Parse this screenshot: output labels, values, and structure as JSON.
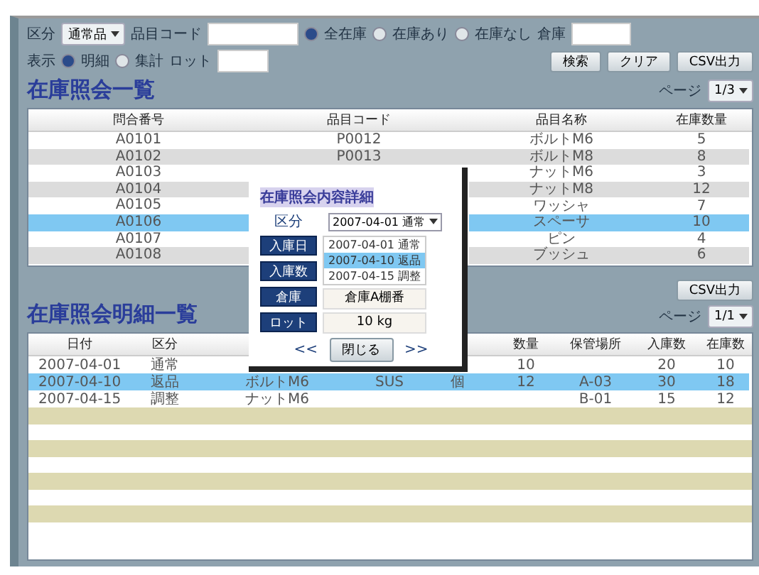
{
  "filters": {
    "type_label": "区分",
    "type_select": "通常品",
    "code_label": "品目コード",
    "stock_radios": [
      {
        "label": "全在庫",
        "selected": true
      },
      {
        "label": "在庫あり",
        "selected": false
      },
      {
        "label": "在庫なし",
        "selected": false
      }
    ],
    "warehouse_label": "倉庫",
    "view_label": "表示",
    "view_radios": [
      {
        "label": "明細",
        "selected": true
      },
      {
        "label": "集計",
        "selected": false
      }
    ],
    "lot_label": "ロット",
    "buttons": [
      "検索",
      "クリア",
      "CSV出力"
    ]
  },
  "list": {
    "title": "在庫照会一覧",
    "page_label": "ページ",
    "page_select": "1/3",
    "columns": [
      "問合番号",
      "品目コード",
      "品目名称",
      "在庫数量"
    ],
    "rows": [
      {
        "cells": [
          "A0101",
          "P0012",
          "ボルトM6",
          "5"
        ],
        "selected": false
      },
      {
        "cells": [
          "A0102",
          "P0013",
          "ボルトM8",
          "8"
        ],
        "selected": false
      },
      {
        "cells": [
          "A0103",
          null,
          "ナットM6",
          "3"
        ],
        "selected": false
      },
      {
        "cells": [
          "A0104",
          null,
          "ナットM8",
          "12"
        ],
        "selected": false
      },
      {
        "cells": [
          "A0105",
          null,
          "ワッシャ",
          "7"
        ],
        "selected": false
      },
      {
        "cells": [
          "A0106",
          null,
          "スペーサ",
          "10"
        ],
        "selected": true
      },
      {
        "cells": [
          "A0107",
          null,
          "ピン",
          "4"
        ],
        "selected": false
      },
      {
        "cells": [
          "A0108",
          null,
          "ブッシュ",
          "6"
        ],
        "selected": false
      }
    ]
  },
  "detail": {
    "title": "在庫照会明細一覧",
    "csv_button": "CSV出力",
    "page_label": "ページ",
    "page_select": "1/1",
    "columns": [
      "日付",
      "区分",
      null,
      null,
      null,
      "数量",
      "保管場所",
      "入庫数",
      "在庫数"
    ],
    "rows": [
      {
        "cells": [
          "2007-04-01",
          "通常",
          null,
          null,
          null,
          "10",
          null,
          "20",
          "10"
        ],
        "selected": false
      },
      {
        "cells": [
          "2007-04-10",
          "返品",
          "ボルトM6",
          "SUS",
          "個",
          "12",
          "A-03",
          "30",
          "18"
        ],
        "selected": true
      },
      {
        "cells": [
          "2007-04-15",
          "調整",
          "ナットM6",
          null,
          null,
          null,
          "B-01",
          "15",
          "12"
        ],
        "selected": false
      }
    ]
  },
  "popup": {
    "title": "在庫照会内容詳細",
    "type_label": "区分",
    "type_select": "2007-04-01 通常",
    "options": [
      {
        "text": "2007-04-01 通常",
        "selected": false
      },
      {
        "text": "2007-04-10 返品",
        "selected": true
      },
      {
        "text": "2007-04-15 調整",
        "selected": false
      }
    ],
    "side_buttons": [
      "入庫日",
      "入庫数",
      "倉庫",
      "ロット"
    ],
    "fields": [
      "倉庫A棚番",
      "10 kg"
    ],
    "prev": "<<",
    "close": "閉じる",
    "next": ">>"
  }
}
